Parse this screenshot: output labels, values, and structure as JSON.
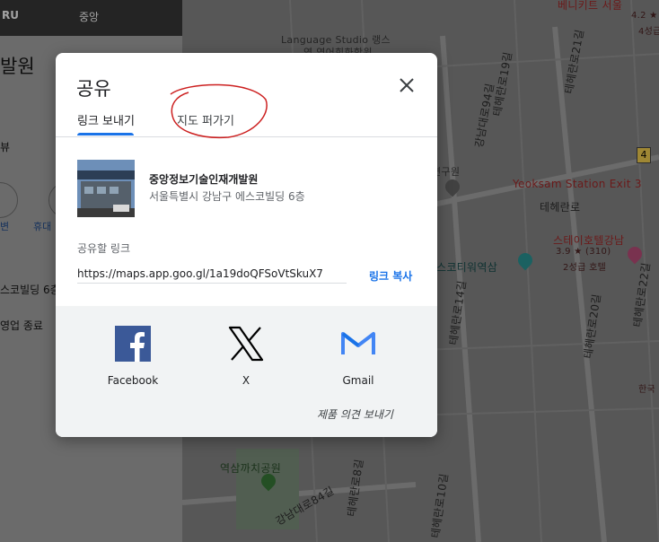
{
  "left_panel": {
    "photo_text_1": "RU",
    "photo_text_2": "중앙",
    "title": "발원",
    "reviews_tab": "뷰",
    "action_1": "변",
    "action_2": "휴대",
    "address": "스코빌딩 6층",
    "hours": "영업 종료"
  },
  "map": {
    "labels": {
      "language_studio": "Language Studio 랭스",
      "language_studio_2": "영 영어회화학원",
      "teheran_19": "테헤란로19길",
      "teheran_21": "테헤란로21길",
      "teheran_road": "테헤란로",
      "gangnam94": "강남대로94길",
      "yeoksam_exit": "Yeoksam Station Exit 3",
      "stay_hotel": "스테이호텔강남",
      "stay_hotel_rating": "3.9 ★ (310)",
      "stay_hotel_class": "2성급 호텔",
      "metro_station": "스코티워역삼",
      "teheran_14": "테헤란로14길",
      "teheran_20": "테헤란로20길",
      "teheran_22": "테헤란로22길",
      "yeoksam_park": "역삼까치공원",
      "gangnam84": "강남대로84길",
      "teheran_8": "테헤란로8길",
      "teheran_10": "테헤란로10길",
      "top_hotel": "베니키트 서울",
      "top_hotel_rating": "4.2 ★",
      "top_hotel_class": "4성급",
      "korea": "한국",
      "research": "연구원",
      "bus_stop_number": "4"
    }
  },
  "dialog": {
    "title": "공유",
    "tabs": [
      {
        "label": "링크 보내기",
        "active": true
      },
      {
        "label": "지도 퍼가기",
        "active": false
      }
    ],
    "place": {
      "name": "중앙정보기술인재개발원",
      "address": "서울특별시 강남구 에스코빌딩 6층"
    },
    "link_label": "공유할 링크",
    "link_value": "https://maps.app.goo.gl/1a19doQFSoVtSkuX7",
    "copy_label": "링크 복사",
    "share_targets": [
      {
        "label": "Facebook",
        "icon": "facebook-icon",
        "color": "#3b5998"
      },
      {
        "label": "X",
        "icon": "x-icon",
        "color": "#000000"
      },
      {
        "label": "Gmail",
        "icon": "gmail-icon",
        "color": "#4285f4"
      }
    ],
    "feedback_label": "제품 의견 보내기",
    "accent_color": "#1a73e8",
    "annotation_color": "#cc1f1f"
  }
}
